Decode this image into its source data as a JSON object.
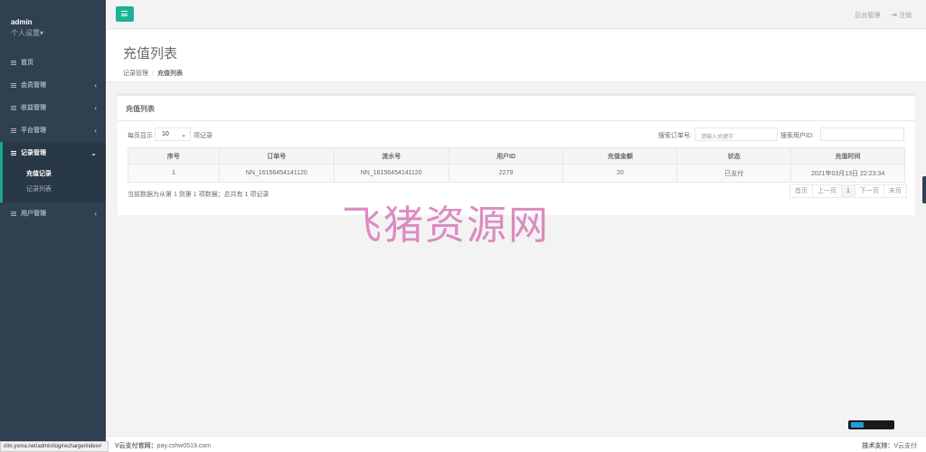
{
  "user": {
    "name": "admin",
    "settings_label": "个人设置"
  },
  "sidebar": {
    "items": [
      {
        "label": "首页"
      },
      {
        "label": "会员管理"
      },
      {
        "label": "收益管理"
      },
      {
        "label": "平台管理"
      },
      {
        "label": "记录管理",
        "sub": [
          {
            "label": "充值记录"
          },
          {
            "label": "记录列表"
          }
        ]
      },
      {
        "label": "用户管理"
      }
    ]
  },
  "topbar": {
    "admin_link": "后台管理",
    "logout": "注销"
  },
  "heading": {
    "title": "充值列表",
    "breadcrumb_parent": "记录管理",
    "breadcrumb_current": "充值列表"
  },
  "panel": {
    "title": "充值列表",
    "length_prefix": "每页显示",
    "length_value": "10",
    "length_suffix": "项记录",
    "search_order_label": "搜索订单号:",
    "search_order_placeholder": "请输入关键字",
    "search_user_label": "搜索用户ID:",
    "columns": [
      "序号",
      "订单号",
      "流水号",
      "用户ID",
      "充值金额",
      "状态",
      "充值时间"
    ],
    "rows": [
      [
        "1",
        "NN_16156454141120",
        "NN_16156454141120",
        "2279",
        "20",
        "已支付",
        "2021年03月13日 22:23:34"
      ]
    ],
    "info": "当前数据为从第 1 到第 1 项数据；总共有 1 项记录",
    "pager": [
      "首页",
      "上一页",
      "1",
      "下一页",
      "末页"
    ]
  },
  "watermark": "飞猪资源网",
  "footer": {
    "left_label": "V云支付官网：",
    "left_value": "pay.cshw0519.com",
    "right_label": "技术支持：",
    "right_value": "V云支付"
  },
  "status_url": "nlm.yxma.net/admin/log/recharge/index#"
}
